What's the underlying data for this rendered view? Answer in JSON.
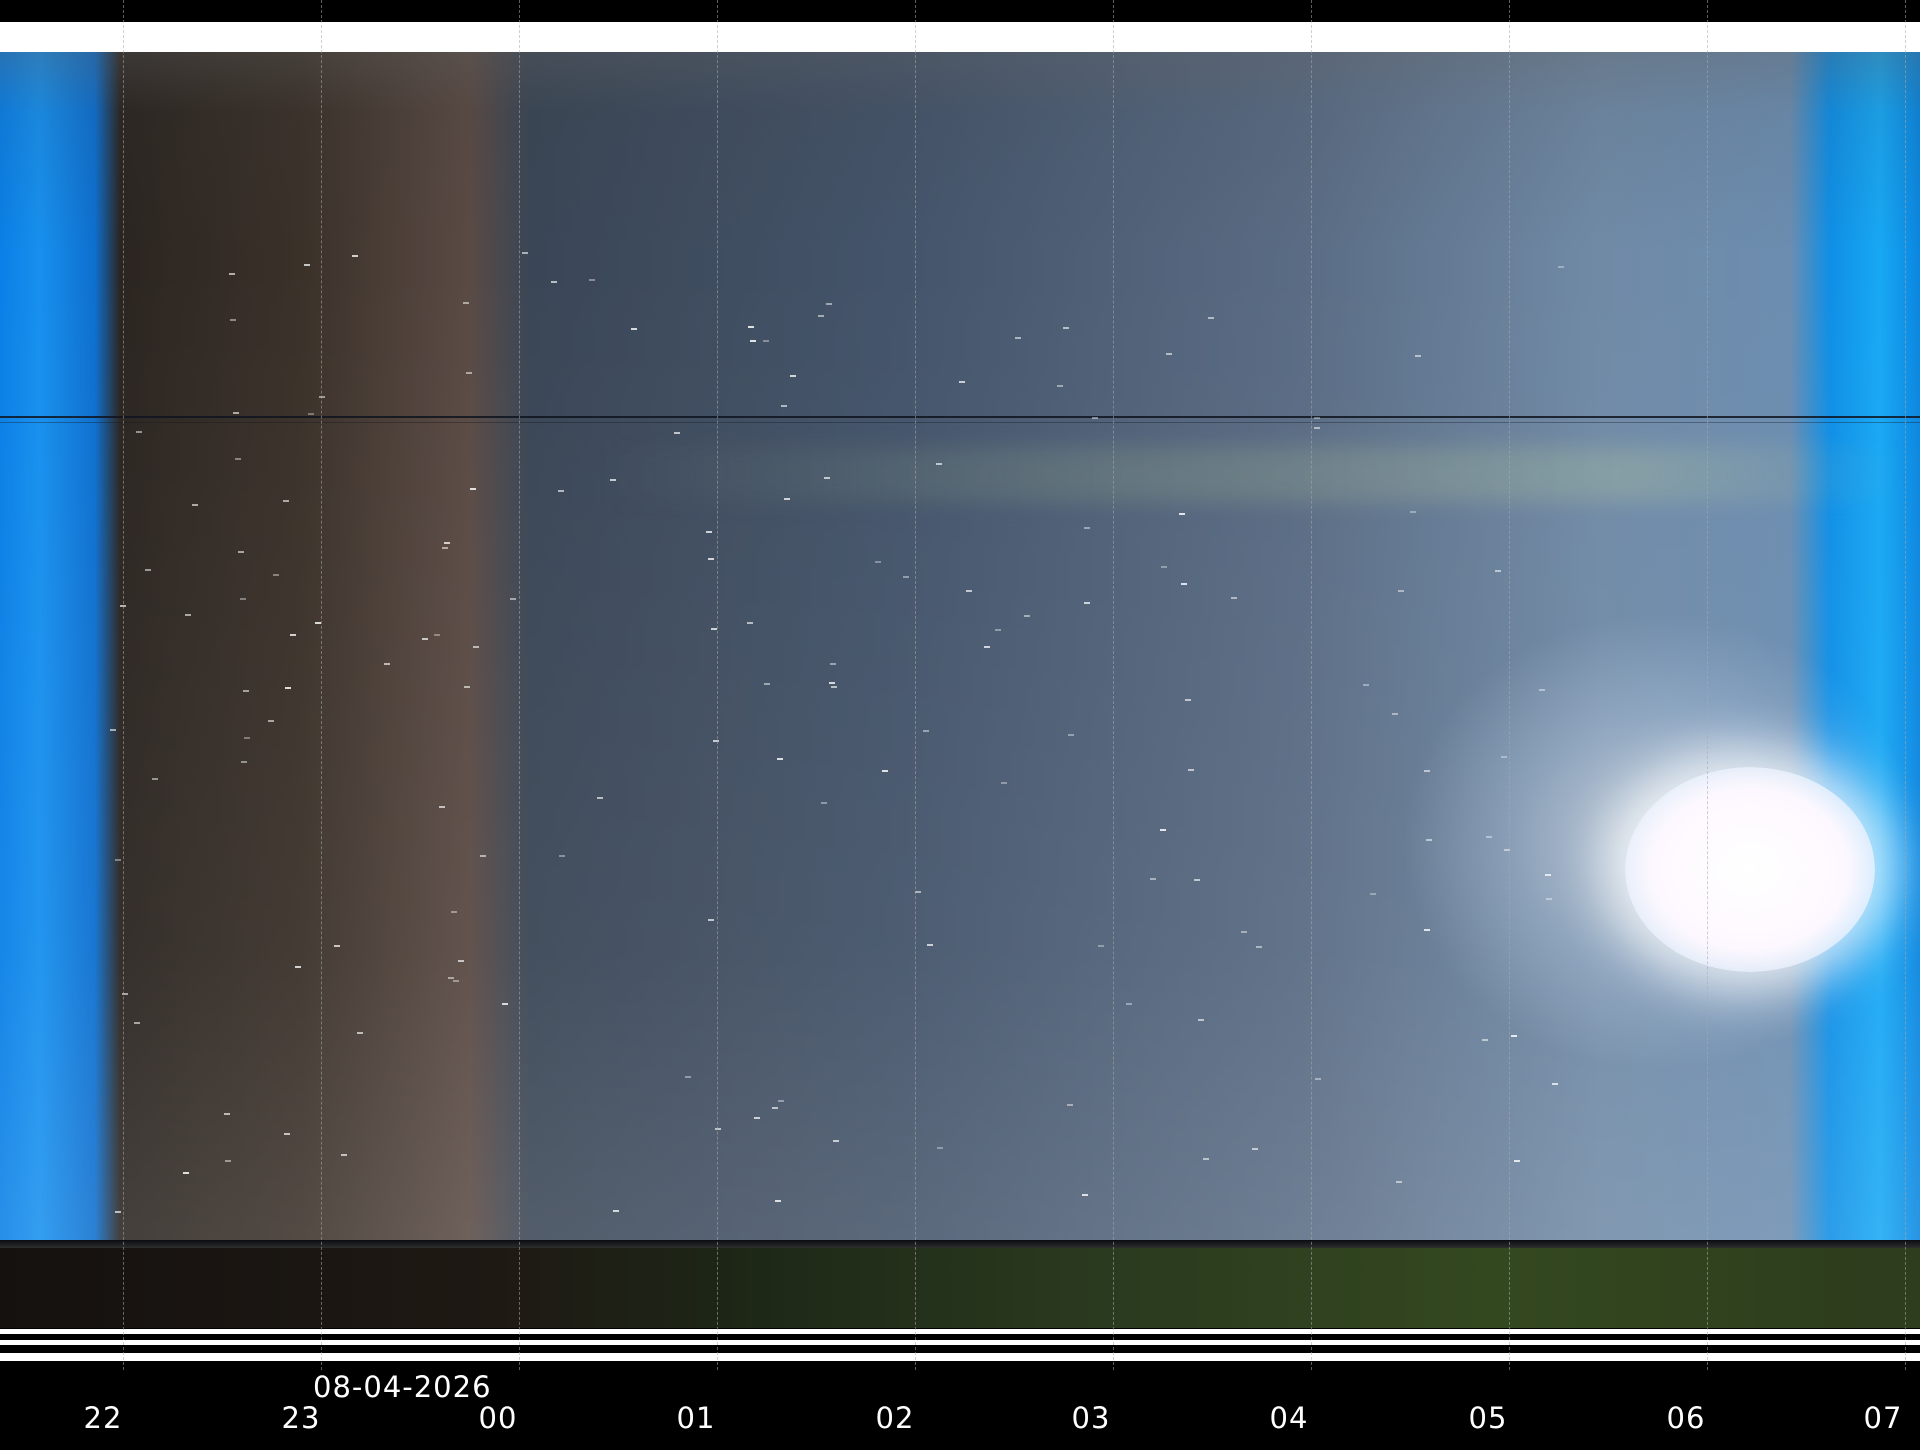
{
  "date": "08-04-2026",
  "hours": [
    "22",
    "23",
    "00",
    "01",
    "02",
    "03",
    "04",
    "05",
    "06",
    "07"
  ]
}
